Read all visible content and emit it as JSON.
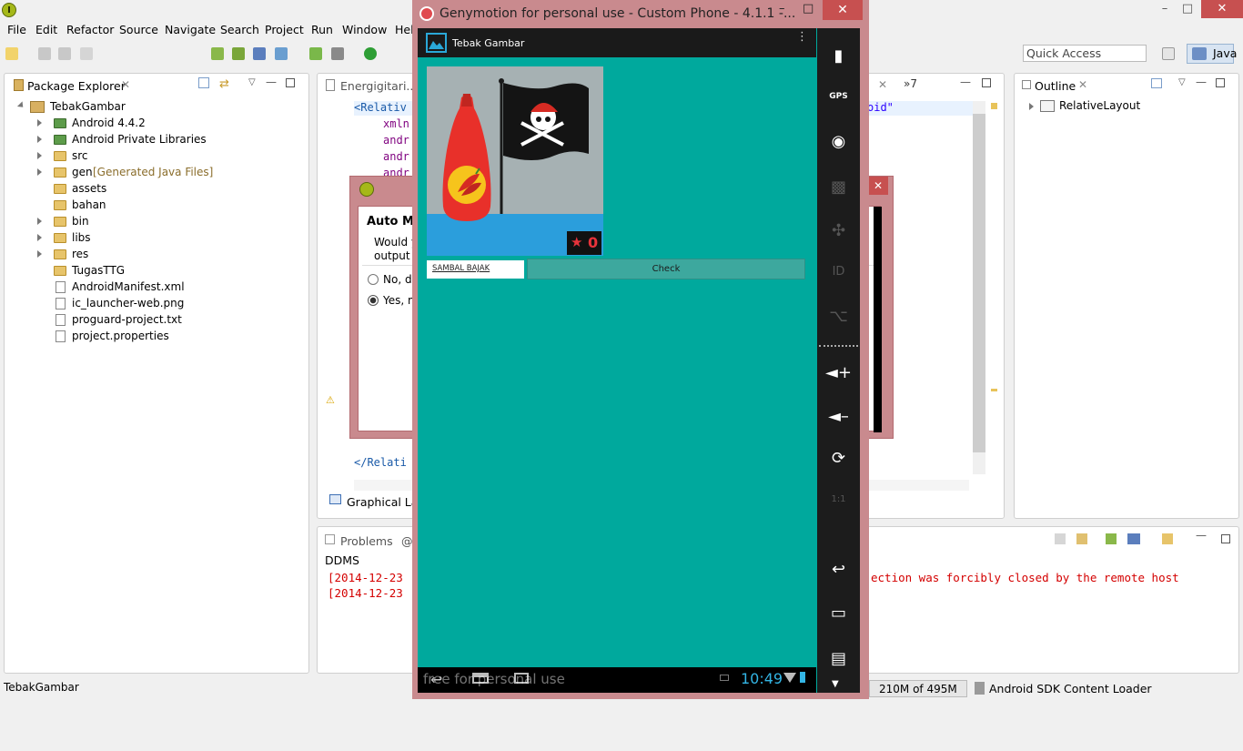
{
  "ide": {
    "window_title": "",
    "menu": [
      "File",
      "Edit",
      "Refactor",
      "Source",
      "Navigate",
      "Search",
      "Project",
      "Run",
      "Window",
      "Hel"
    ],
    "quick_access_placeholder": "Quick Access",
    "perspective": "Java"
  },
  "package_explorer": {
    "title": "Package Explorer",
    "project": "TebakGambar",
    "items": [
      {
        "label": "Android 4.4.2",
        "type": "lib",
        "expandable": true
      },
      {
        "label": "Android Private Libraries",
        "type": "lib",
        "expandable": true
      },
      {
        "label": "src",
        "type": "folder",
        "expandable": true
      },
      {
        "label": "gen",
        "note": "[Generated Java Files]",
        "type": "folder",
        "expandable": true
      },
      {
        "label": "assets",
        "type": "folder",
        "expandable": false
      },
      {
        "label": "bahan",
        "type": "folder",
        "expandable": false
      },
      {
        "label": "bin",
        "type": "folder",
        "expandable": true
      },
      {
        "label": "libs",
        "type": "folder",
        "expandable": true
      },
      {
        "label": "res",
        "type": "folder",
        "expandable": true
      },
      {
        "label": "TugasTTG",
        "type": "folder",
        "expandable": false
      },
      {
        "label": "AndroidManifest.xml",
        "type": "file",
        "expandable": false
      },
      {
        "label": "ic_launcher-web.png",
        "type": "file",
        "expandable": false
      },
      {
        "label": "proguard-project.txt",
        "type": "file",
        "expandable": false
      },
      {
        "label": "project.properties",
        "type": "file",
        "expandable": false
      }
    ]
  },
  "editor": {
    "tab": "Energigitari...",
    "overflow": "»7",
    "code_lines": [
      "<Relativ",
      "xmln",
      "andr",
      "andr",
      "andr"
    ],
    "right_fragment": "oid\"",
    "closing": "</Relati",
    "bottom_tab": "Graphical Lay"
  },
  "dialog": {
    "heading": "Auto Mo",
    "text1": "Would y",
    "text2": "output f",
    "option_no": "No, do",
    "option_yes": "Yes, m"
  },
  "outline": {
    "title": "Outline",
    "item": "RelativeLayout"
  },
  "console": {
    "tab_problems": "Problems",
    "tab_at": "@",
    "label": "DDMS",
    "line1": "[2014-12-23",
    "line2": "[2014-12-23",
    "line1_tail": "ection was forcibly closed by the remote host"
  },
  "status": {
    "left": "TebakGambar",
    "memory": "210M of 495M",
    "loader": "Android SDK Content Loader"
  },
  "genymotion": {
    "title": "Genymotion for personal use - Custom Phone - 4.1.1 -...",
    "app_title": "Tebak Gambar",
    "star_count": "0",
    "answer_value": "SAMBAL BAJAK",
    "check_label": "Check",
    "watermark": "free for personal use",
    "clock": "10:49",
    "colors": {
      "screen": "#00a99d",
      "check_button": "#3da89e",
      "badge_star": "#e8333b"
    }
  }
}
